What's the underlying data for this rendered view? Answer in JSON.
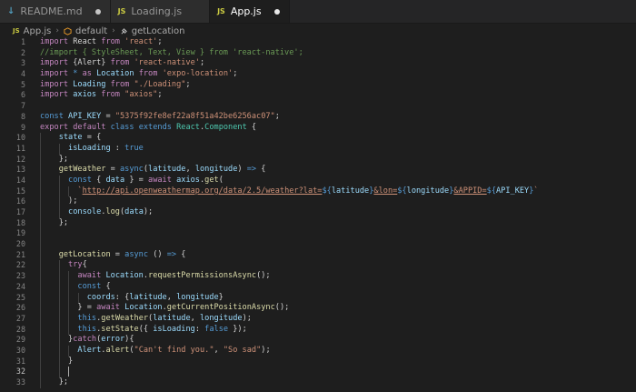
{
  "tabs": [
    {
      "label": "README.md",
      "icon": "markdown-icon",
      "active": false,
      "modified": true
    },
    {
      "label": "Loading.js",
      "icon": "js-file-icon",
      "active": false,
      "modified": false
    },
    {
      "label": "App.js",
      "icon": "js-file-icon",
      "active": true,
      "modified": true
    }
  ],
  "js_badge": "JS",
  "breadcrumb": {
    "file": "App.js",
    "class": "default",
    "method": "getLocation"
  },
  "editor": {
    "lines": [
      {
        "n": "1"
      },
      {
        "n": "2"
      },
      {
        "n": "3"
      },
      {
        "n": "4"
      },
      {
        "n": "5"
      },
      {
        "n": "6"
      },
      {
        "n": "7"
      },
      {
        "n": "8"
      },
      {
        "n": "9"
      },
      {
        "n": "10"
      },
      {
        "n": "11"
      },
      {
        "n": "12"
      },
      {
        "n": "13"
      },
      {
        "n": "14"
      },
      {
        "n": "15"
      },
      {
        "n": "16"
      },
      {
        "n": "17"
      },
      {
        "n": "18"
      },
      {
        "n": "19"
      },
      {
        "n": "20"
      },
      {
        "n": "21"
      },
      {
        "n": "22"
      },
      {
        "n": "23"
      },
      {
        "n": "24"
      },
      {
        "n": "25"
      },
      {
        "n": "26"
      },
      {
        "n": "27"
      },
      {
        "n": "28"
      },
      {
        "n": "29"
      },
      {
        "n": "30"
      },
      {
        "n": "31"
      },
      {
        "n": "32"
      },
      {
        "n": "33"
      }
    ],
    "code": {
      "l1": [
        "import",
        " React ",
        "from",
        " 'react'",
        ";"
      ],
      "l2": "//import { StyleSheet, Text, View } from 'react-native';",
      "l3": [
        "import",
        " {Alert} ",
        "from",
        " 'react-native'",
        ";"
      ],
      "l4": [
        "import",
        " * ",
        "as",
        " Location ",
        "from",
        " 'expo-location'",
        ";"
      ],
      "l5": [
        "import",
        " Loading ",
        "from",
        " \"./Loading\"",
        ";"
      ],
      "l6": [
        "import",
        " axios ",
        "from",
        " \"axios\"",
        ";"
      ],
      "l8": [
        "const",
        " API_KEY",
        " = ",
        "\"5375f92fe8ef22a8f51a42be6256ac07\"",
        ";"
      ],
      "l9": [
        "export",
        " ",
        "default",
        " ",
        "class",
        " ",
        "extends",
        " ",
        "React",
        ".",
        "Component",
        " {"
      ],
      "l10": [
        "state",
        " = {"
      ],
      "l11": [
        "isLoading",
        " : ",
        "true"
      ],
      "l12": "};",
      "l13": [
        "getWeather",
        " = ",
        "async",
        "(",
        "latitude",
        ", ",
        "longitude",
        ") ",
        "=>",
        " {"
      ],
      "l14": [
        "const",
        " { ",
        "data",
        " } = ",
        "await",
        " ",
        "axios",
        ".",
        "get",
        "("
      ],
      "l15": [
        "`",
        "http://api.openweathermap.org/data/2.5/weather?lat=",
        "${",
        "latitude",
        "}",
        "&lon=",
        "${",
        "longitude",
        "}",
        "&APPID=",
        "${",
        "API_KEY",
        "}",
        "`"
      ],
      "l16": ");",
      "l17": [
        "console",
        ".",
        "log",
        "(",
        "data",
        ");"
      ],
      "l18": "};",
      "l21": [
        "getLocation",
        " = ",
        "async",
        " () ",
        "=>",
        " {"
      ],
      "l22": [
        "try",
        "{"
      ],
      "l23": [
        "await",
        " ",
        "Location",
        ".",
        "requestPermissionsAsync",
        "();"
      ],
      "l24": [
        "const",
        " {"
      ],
      "l25": [
        "coords",
        ": {",
        "latitude",
        ", ",
        "longitude",
        "}"
      ],
      "l26": [
        "} = ",
        "await",
        " ",
        "Location",
        ".",
        "getCurrentPositionAsync",
        "();"
      ],
      "l27": [
        "this",
        ".",
        "getWeather",
        "(",
        "latitude",
        ", ",
        "longitude",
        ");"
      ],
      "l28": [
        "this",
        ".",
        "setState",
        "({ ",
        "isLoading",
        ": ",
        "false",
        " });"
      ],
      "l29": [
        "}",
        "catch",
        "(",
        "error",
        "){"
      ],
      "l30": [
        "Alert",
        ".",
        "alert",
        "(",
        "\"Can't find you.\"",
        ", ",
        "\"So sad\"",
        ");"
      ],
      "l31": "}",
      "l33": "};"
    },
    "current_line": "32"
  },
  "colors": {
    "background": "#1e1e1e",
    "keyword": "#569cd6",
    "control": "#c586c0",
    "string": "#ce9178",
    "variable": "#9cdcfe",
    "function": "#dcdcaa",
    "class": "#4ec9b0",
    "comment": "#6a9955"
  }
}
